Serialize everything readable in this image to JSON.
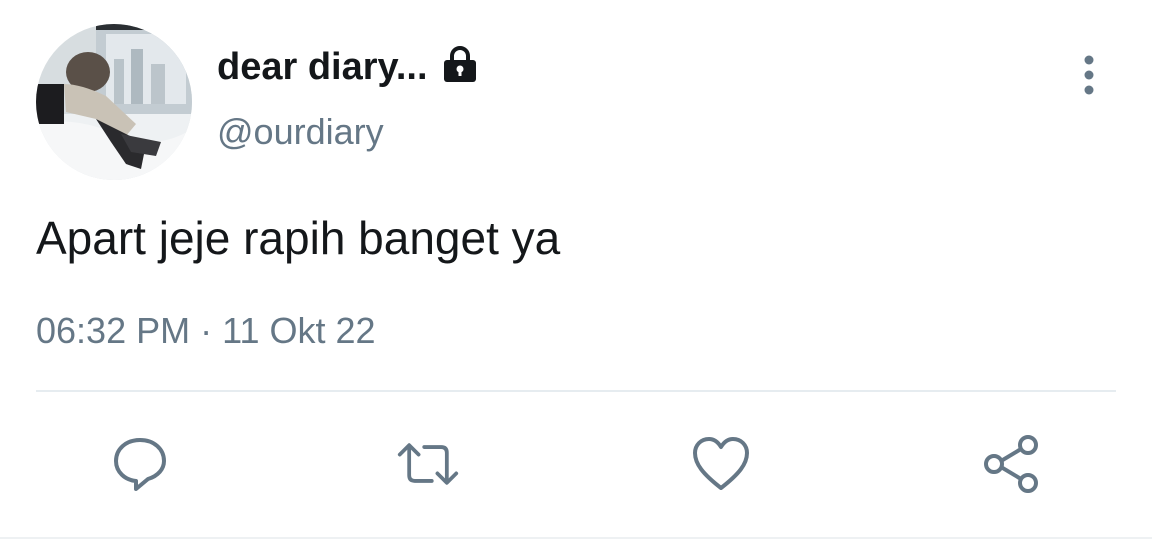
{
  "tweet": {
    "display_name": "dear diary...",
    "handle": "@ourdiary",
    "text": "Apart jeje rapih banget ya",
    "time": "06:32 PM",
    "separator": "·",
    "date": "11 Okt 22",
    "protected_icon": "lock-icon",
    "avatar": "profile-photo"
  },
  "actions": [
    {
      "name": "reply",
      "icon": "speech-bubble-icon"
    },
    {
      "name": "retweet",
      "icon": "retweet-arrows-icon"
    },
    {
      "name": "like",
      "icon": "heart-icon"
    },
    {
      "name": "share",
      "icon": "share-icon"
    }
  ],
  "colors": {
    "text_primary": "#14171a",
    "text_secondary": "#657786",
    "divider": "#e6ecf0",
    "icon": "#657786"
  }
}
